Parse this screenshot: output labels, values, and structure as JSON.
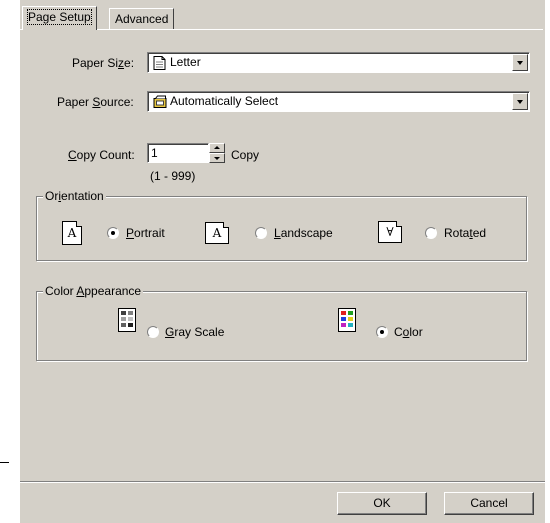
{
  "tabs": [
    {
      "label": "Page Setup",
      "active": true
    },
    {
      "label": "Advanced",
      "active": false
    }
  ],
  "paper_size": {
    "label_pre": "Paper Si",
    "label_key": "z",
    "label_post": "e:",
    "value": "Letter",
    "icon": "document-icon"
  },
  "paper_source": {
    "label_pre": "Paper ",
    "label_key": "S",
    "label_post": "ource:",
    "value": "Automatically Select",
    "icon": "tray-icon"
  },
  "copy_count": {
    "label_key": "C",
    "label_post": "opy Count:",
    "value": "1",
    "unit": "Copy",
    "range": "(1 - 999)"
  },
  "orientation": {
    "legend_pre": "Or",
    "legend_key": "i",
    "legend_post": "entation",
    "options": [
      {
        "pre": "",
        "key": "P",
        "post": "ortrait",
        "selected": true,
        "icon_letter": "A"
      },
      {
        "pre": "",
        "key": "L",
        "post": "andscape",
        "selected": false,
        "icon_letter": "A"
      },
      {
        "pre": "Rota",
        "key": "t",
        "post": "ed",
        "selected": false,
        "icon_letter": "∀"
      }
    ]
  },
  "color_appearance": {
    "legend_pre": "Color ",
    "legend_key": "A",
    "legend_post": "ppearance",
    "options": [
      {
        "pre": "",
        "key": "G",
        "post": "ray Scale",
        "selected": false
      },
      {
        "pre": "C",
        "key": "o",
        "post": "lor",
        "selected": true
      }
    ]
  },
  "buttons": {
    "ok": "OK",
    "cancel": "Cancel"
  },
  "colors": {
    "face": "#d4d0c8",
    "shadow": "#808080",
    "dark": "#404040",
    "highlight": "#ffffff"
  }
}
